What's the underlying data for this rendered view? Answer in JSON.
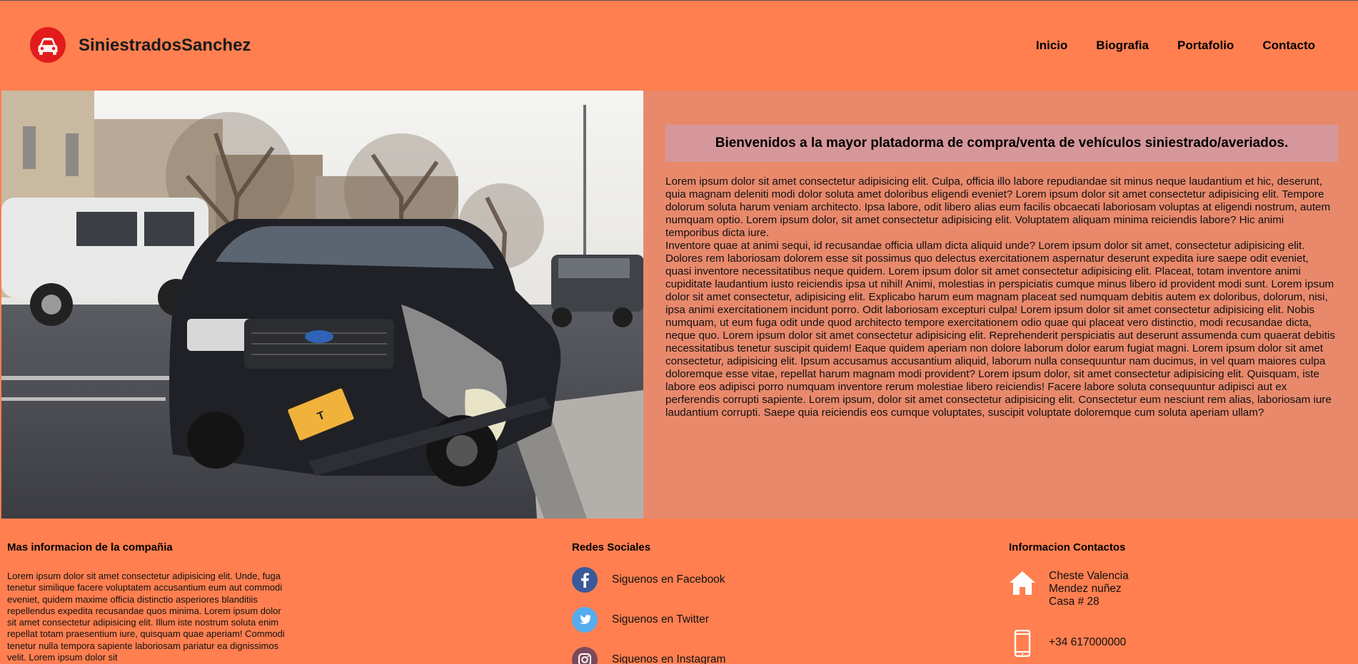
{
  "header": {
    "brand": "SiniestradosSanchez",
    "logo_icon": "car-icon",
    "nav": [
      "Inicio",
      "Biografia",
      "Portafolio",
      "Contacto"
    ]
  },
  "hero": {
    "image": "wrecked-car-photo"
  },
  "main": {
    "welcome": "Bienvenidos a la mayor platadorma de compra/venta de vehículos siniestrado/averiados.",
    "paragraphs": [
      "Lorem ipsum dolor sit amet consectetur adipisicing elit. Culpa, officia illo labore repudiandae sit minus neque laudantium et hic, deserunt, quia magnam deleniti modi dolor soluta amet doloribus eligendi eveniet? Lorem ipsum dolor sit amet consectetur adipisicing elit. Tempore dolorum soluta harum veniam architecto. Ipsa labore, odit libero alias eum facilis obcaecati laboriosam voluptas at eligendi nostrum, autem numquam optio. Lorem ipsum dolor, sit amet consectetur adipisicing elit. Voluptatem aliquam minima reiciendis labore? Hic animi temporibus dicta iure.",
      "Inventore quae at animi sequi, id recusandae officia ullam dicta aliquid unde? Lorem ipsum dolor sit amet, consectetur adipisicing elit. Dolores rem laboriosam dolorem esse sit possimus quo delectus exercitationem aspernatur deserunt expedita iure saepe odit eveniet,",
      "quasi inventore necessitatibus neque quidem. Lorem ipsum dolor sit amet consectetur adipisicing elit. Placeat, totam inventore animi cupiditate laudantium iusto reiciendis ipsa ut nihil! Animi, molestias in perspiciatis cumque minus libero id provident modi sunt. Lorem ipsum dolor sit amet consectetur, adipisicing elit. Explicabo harum eum magnam placeat sed numquam debitis autem ex doloribus, dolorum, nisi, ipsa animi exercitationem incidunt porro. Odit laboriosam excepturi culpa! Lorem ipsum dolor sit amet consectetur adipisicing elit. Nobis numquam, ut eum fuga odit unde quod architecto tempore exercitationem odio quae qui placeat vero distinctio, modi recusandae dicta, neque quo. Lorem ipsum dolor sit amet consectetur adipisicing elit. Reprehenderit perspiciatis aut deserunt assumenda cum quaerat debitis necessitatibus tenetur suscipit quidem! Eaque quidem aperiam non dolore laborum dolor earum fugiat magni. Lorem ipsum dolor sit amet consectetur, adipisicing elit. Ipsum accusamus accusantium aliquid, laborum nulla consequuntur nam ducimus, in vel quam maiores culpa doloremque esse vitae, repellat harum magnam modi provident? Lorem ipsum dolor, sit amet consectetur adipisicing elit. Quisquam, iste labore eos adipisci porro numquam inventore rerum molestiae libero reiciendis! Facere labore soluta consequuntur adipisci aut ex perferendis corrupti sapiente. Lorem ipsum, dolor sit amet consectetur adipisicing elit. Consectetur eum nesciunt rem alias, laboriosam iure laudantium corrupti. Saepe quia reiciendis eos cumque voluptates, suscipit voluptate doloremque cum soluta aperiam ullam?"
    ]
  },
  "footer": {
    "info": {
      "title": "Mas informacion de la compañia",
      "text": "Lorem ipsum dolor sit amet consectetur adipisicing elit. Unde, fuga tenetur similique facere voluptatem accusantium eum aut commodi eveniet, quidem maxime officia distinctio asperiores blanditiis repellendus expedita recusandae quos minima. Lorem ipsum dolor sit amet consectetur adipisicing elit. Illum iste nostrum soluta enim repellat totam praesentium iure, quisquam quae aperiam! Commodi tenetur nulla tempora sapiente laboriosam pariatur ea dignissimos velit. Lorem ipsum dolor sit"
    },
    "social": {
      "title": "Redes Sociales",
      "items": [
        {
          "label": "Siguenos en Facebook",
          "icon": "facebook-icon",
          "color": "#3b5998"
        },
        {
          "label": "Siguenos en Twitter",
          "icon": "twitter-icon",
          "color": "#55acee"
        },
        {
          "label": "Siguenos en Instagram",
          "icon": "instagram-icon",
          "color": "#8a3ab9"
        }
      ]
    },
    "contact": {
      "title": "Informacion Contactos",
      "address": [
        "Cheste Valencia",
        "Mendez nuñez",
        "Casa # 28"
      ],
      "phone": "+34 617000000",
      "address_icon": "home-icon",
      "phone_icon": "phone-icon"
    }
  },
  "colors": {
    "accent": "#ff7f50",
    "content_bg": "#e8896c",
    "welcome_bg": "#d6979a",
    "logo": "#e21b1b"
  }
}
